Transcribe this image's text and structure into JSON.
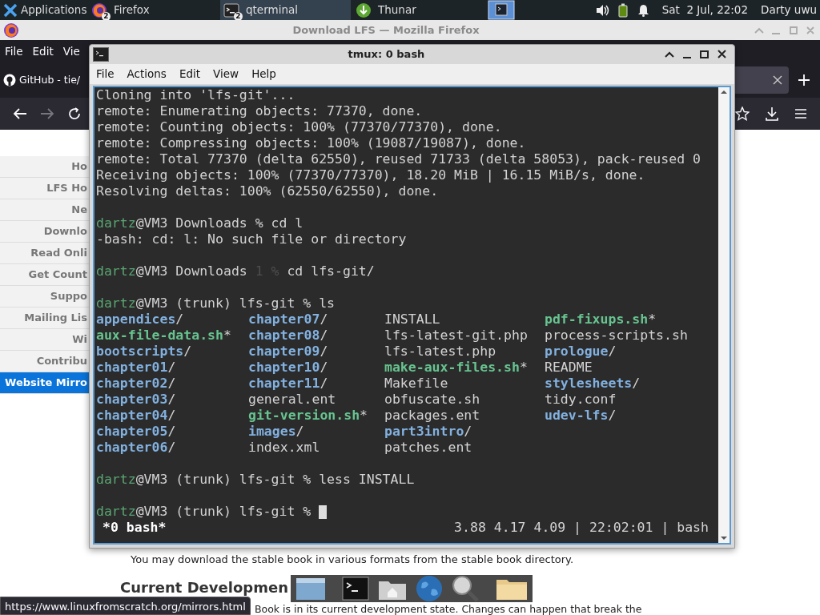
{
  "taskbar": {
    "apps_label": "Applications",
    "tasks": [
      {
        "label": "Firefox",
        "badge": "2",
        "kind": "browser",
        "selected": false
      },
      {
        "label": "qterminal",
        "badge": "2",
        "kind": "terminal",
        "selected": true
      },
      {
        "label": "Thunar",
        "kind": "files",
        "selected": false
      }
    ],
    "clock": "Sat  2 Jul, 22:02",
    "user": "Darty uwu"
  },
  "firefox": {
    "title": "Download LFS — Mozilla Firefox",
    "menu": [
      "File",
      "Edit",
      "Vie"
    ],
    "tab": "GitHub - tie/",
    "nav": [
      {
        "label": "Ho",
        "selected": false
      },
      {
        "label": "LFS Ho",
        "selected": false
      },
      {
        "label": "Ne",
        "selected": false
      },
      {
        "label": "Downlo",
        "selected": false
      },
      {
        "label": "Read Onli",
        "selected": false
      },
      {
        "label": "Get Count",
        "selected": false
      },
      {
        "label": "Suppo",
        "selected": false
      },
      {
        "label": "Mailing Lis",
        "selected": false
      },
      {
        "label": "Wi",
        "selected": false
      },
      {
        "label": "Contribu",
        "selected": false
      },
      {
        "label": "Website Mirro",
        "selected": true
      }
    ],
    "paragraph": {
      "before": "You may download the stable book in various formats from the ",
      "link": "stable book",
      "after": " directory."
    },
    "heading": "Current Developmen",
    "line": "Book is in its current development state. Changes can happen that break the",
    "status_url": "https://www.linuxfromscratch.org/mirrors.html"
  },
  "terminal": {
    "title": "tmux: 0 bash",
    "menu": [
      "File",
      "Actions",
      "Edit",
      "View",
      "Help"
    ],
    "lines": [
      {
        "kind": "text",
        "segments": [
          {
            "text": "Cloning into 'lfs-git'...",
            "kind": "plain"
          }
        ]
      },
      {
        "kind": "text",
        "segments": [
          {
            "text": "remote: Enumerating objects: 77370, done.",
            "kind": "plain"
          }
        ]
      },
      {
        "kind": "text",
        "segments": [
          {
            "text": "remote: Counting objects: 100% (77370/77370), done.",
            "kind": "plain"
          }
        ]
      },
      {
        "kind": "text",
        "segments": [
          {
            "text": "remote: Compressing objects: 100% (19087/19087), done.",
            "kind": "plain"
          }
        ]
      },
      {
        "kind": "text",
        "segments": [
          {
            "text": "remote: Total 77370 (delta 62550), reused 71733 (delta 58053), pack-reused 0",
            "kind": "plain"
          }
        ]
      },
      {
        "kind": "text",
        "segments": [
          {
            "text": "Receiving objects: 100% (77370/77370), 18.20 MiB | 16.15 MiB/s, done.",
            "kind": "plain"
          }
        ]
      },
      {
        "kind": "text",
        "segments": [
          {
            "text": "Resolving deltas: 100% (62550/62550), done.",
            "kind": "plain"
          }
        ]
      },
      {
        "kind": "blank"
      },
      {
        "kind": "text",
        "segments": [
          {
            "text": "dartz",
            "kind": "user"
          },
          {
            "text": "@VM3 Downloads % cd l",
            "kind": "plain"
          }
        ]
      },
      {
        "kind": "text",
        "segments": [
          {
            "text": "-bash: cd: l: No such file or directory",
            "kind": "plain"
          }
        ]
      },
      {
        "kind": "blank"
      },
      {
        "kind": "text",
        "segments": [
          {
            "text": "dartz",
            "kind": "user"
          },
          {
            "text": "@VM3 Downloads ",
            "kind": "plain"
          },
          {
            "text": "1 %",
            "kind": "dim"
          },
          {
            "text": " cd lfs-git/",
            "kind": "plain"
          }
        ]
      },
      {
        "kind": "blank"
      },
      {
        "kind": "text",
        "segments": [
          {
            "text": "dartz",
            "kind": "user"
          },
          {
            "text": "@VM3 (trunk) lfs-git % ls",
            "kind": "plain"
          }
        ]
      },
      {
        "kind": "columns",
        "cells": [
          {
            "name": "appendices",
            "kind": "dir",
            "suffix": "/"
          },
          {
            "name": "chapter07",
            "kind": "dir",
            "suffix": "/"
          },
          {
            "name": "INSTALL",
            "kind": "plain"
          },
          {
            "name": "pdf-fixups.sh",
            "kind": "exec",
            "suffix": "*"
          }
        ]
      },
      {
        "kind": "columns",
        "cells": [
          {
            "name": "aux-file-data.sh",
            "kind": "exec",
            "suffix": "*"
          },
          {
            "name": "chapter08",
            "kind": "dir",
            "suffix": "/"
          },
          {
            "name": "lfs-latest-git.php",
            "kind": "plain"
          },
          {
            "name": "process-scripts.sh",
            "kind": "plain"
          }
        ]
      },
      {
        "kind": "columns",
        "cells": [
          {
            "name": "bootscripts",
            "kind": "dir",
            "suffix": "/"
          },
          {
            "name": "chapter09",
            "kind": "dir",
            "suffix": "/"
          },
          {
            "name": "lfs-latest.php",
            "kind": "plain"
          },
          {
            "name": "prologue",
            "kind": "dir",
            "suffix": "/"
          }
        ]
      },
      {
        "kind": "columns",
        "cells": [
          {
            "name": "chapter01",
            "kind": "dir",
            "suffix": "/"
          },
          {
            "name": "chapter10",
            "kind": "dir",
            "suffix": "/"
          },
          {
            "name": "make-aux-files.sh",
            "kind": "exec",
            "suffix": "*"
          },
          {
            "name": "README",
            "kind": "plain"
          }
        ]
      },
      {
        "kind": "columns",
        "cells": [
          {
            "name": "chapter02",
            "kind": "dir",
            "suffix": "/"
          },
          {
            "name": "chapter11",
            "kind": "dir",
            "suffix": "/"
          },
          {
            "name": "Makefile",
            "kind": "plain"
          },
          {
            "name": "stylesheets",
            "kind": "dir",
            "suffix": "/"
          }
        ]
      },
      {
        "kind": "columns",
        "cells": [
          {
            "name": "chapter03",
            "kind": "dir",
            "suffix": "/"
          },
          {
            "name": "general.ent",
            "kind": "plain"
          },
          {
            "name": "obfuscate.sh",
            "kind": "plain"
          },
          {
            "name": "tidy.conf",
            "kind": "plain"
          }
        ]
      },
      {
        "kind": "columns",
        "cells": [
          {
            "name": "chapter04",
            "kind": "dir",
            "suffix": "/"
          },
          {
            "name": "git-version.sh",
            "kind": "exec",
            "suffix": "*"
          },
          {
            "name": "packages.ent",
            "kind": "plain"
          },
          {
            "name": "udev-lfs",
            "kind": "dir",
            "suffix": "/"
          }
        ]
      },
      {
        "kind": "columns",
        "cells": [
          {
            "name": "chapter05",
            "kind": "dir",
            "suffix": "/"
          },
          {
            "name": "images",
            "kind": "dir",
            "suffix": "/"
          },
          {
            "name": "part3intro",
            "kind": "dir",
            "suffix": "/"
          }
        ]
      },
      {
        "kind": "columns",
        "cells": [
          {
            "name": "chapter06",
            "kind": "dir",
            "suffix": "/"
          },
          {
            "name": "index.xml",
            "kind": "plain"
          },
          {
            "name": "patches.ent",
            "kind": "plain"
          }
        ]
      },
      {
        "kind": "blank"
      },
      {
        "kind": "text",
        "segments": [
          {
            "text": "dartz",
            "kind": "user"
          },
          {
            "text": "@VM3 (trunk) lfs-git % less INSTALL",
            "kind": "plain"
          }
        ]
      },
      {
        "kind": "blank"
      },
      {
        "kind": "text",
        "cursor": true,
        "segments": [
          {
            "text": "dartz",
            "kind": "user"
          },
          {
            "text": "@VM3 (trunk) lfs-git % ",
            "kind": "plain"
          }
        ]
      }
    ],
    "status": {
      "window": "*0 bash*",
      "info": "3.88 4.17 4.09 | 22:02:01 | bash"
    }
  }
}
